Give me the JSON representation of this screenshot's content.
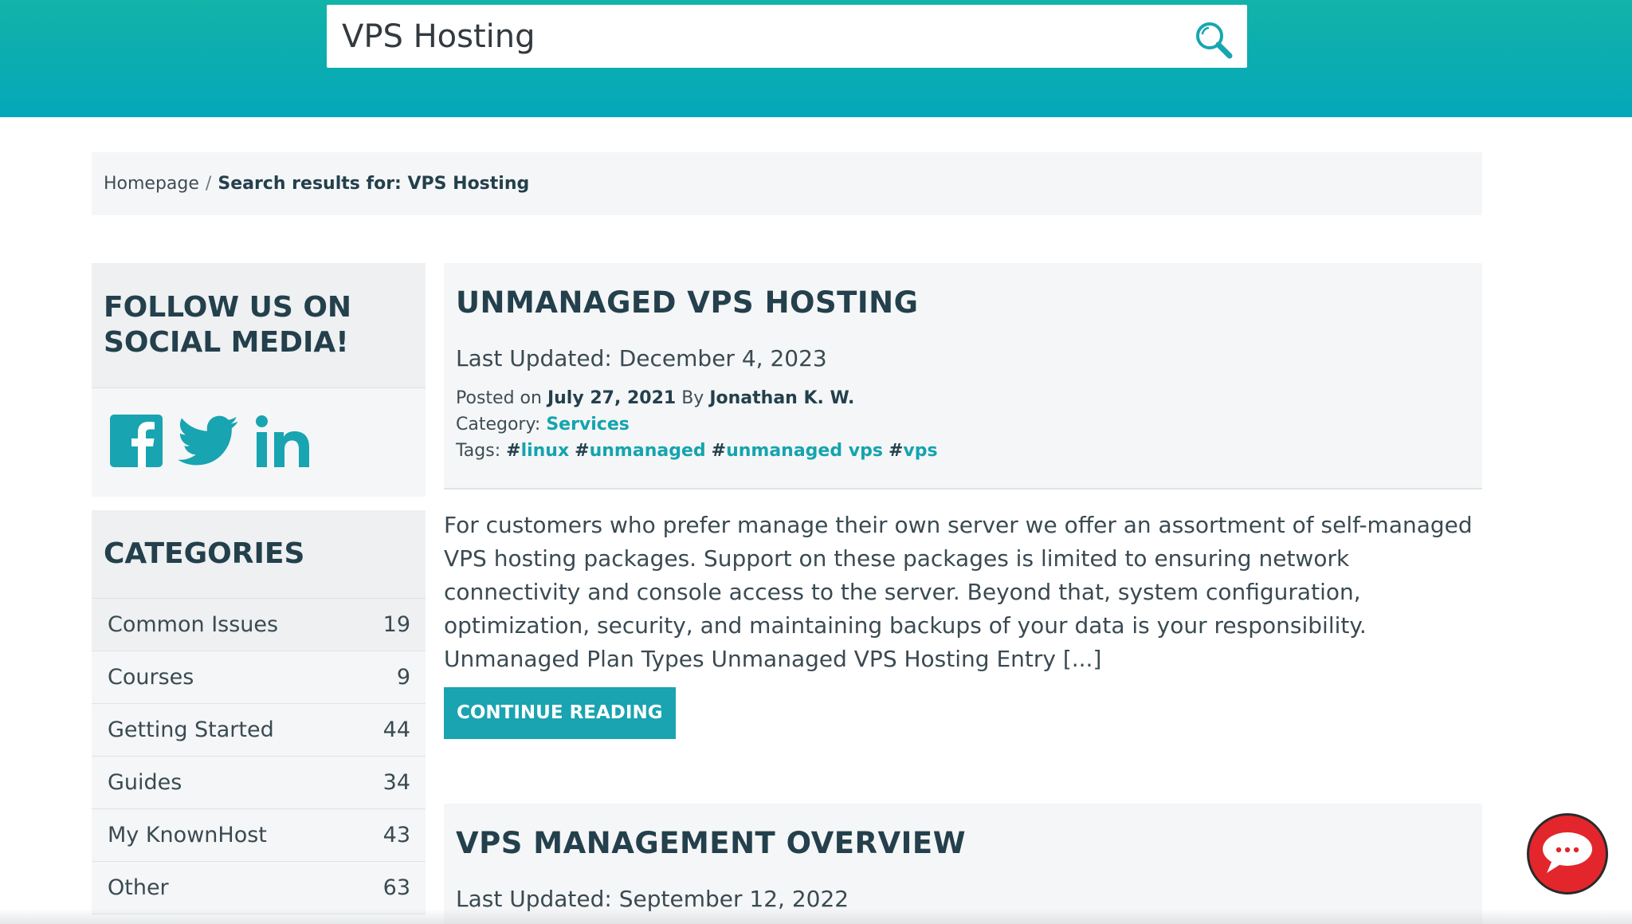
{
  "search": {
    "value": "VPS Hosting"
  },
  "breadcrumb": {
    "home": "Homepage",
    "separator": "/",
    "current": "Search results for: VPS Hosting"
  },
  "sidebar": {
    "social_title_line1": "FOLLOW US ON",
    "social_title_line2": "SOCIAL MEDIA!",
    "social_icons": [
      "facebook-icon",
      "twitter-icon",
      "linkedin-icon"
    ],
    "categories_title": "CATEGORIES",
    "categories": [
      {
        "name": "Common Issues",
        "count": "19"
      },
      {
        "name": "Courses",
        "count": "9"
      },
      {
        "name": "Getting Started",
        "count": "44"
      },
      {
        "name": "Guides",
        "count": "34"
      },
      {
        "name": "My KnownHost",
        "count": "43"
      },
      {
        "name": "Other",
        "count": "63"
      }
    ]
  },
  "posts": [
    {
      "title": "UNMANAGED VPS HOSTING",
      "updated": "Last Updated: December 4, 2023",
      "posted_on_label": "Posted on",
      "posted_date": "July 27, 2021",
      "by_label": "By",
      "author": "Jonathan K. W.",
      "category_label": "Category:",
      "category": "Services",
      "tags_label": "Tags:",
      "tags": [
        "linux",
        "unmanaged",
        "unmanaged vps",
        "vps"
      ],
      "excerpt": "For customers who prefer manage their own server we offer an assortment of self-managed VPS hosting packages. Support on these packages is limited to ensuring network connectivity and console access to the server. Beyond that, system configuration, optimization, security, and maintaining backups of your data is your responsibility. Unmanaged Plan Types Unmanaged VPS Hosting Entry [...]",
      "cta": "CONTINUE READING"
    },
    {
      "title": "VPS MANAGEMENT OVERVIEW",
      "updated": "Last Updated: September 12, 2022"
    }
  ],
  "colors": {
    "brand_teal": "#14a4ae",
    "header_top": "#12b3a8",
    "header_bottom": "#04a7b9",
    "chat_red": "#e3262b"
  },
  "icons": {
    "search": "search-icon",
    "chat": "chat-icon"
  }
}
